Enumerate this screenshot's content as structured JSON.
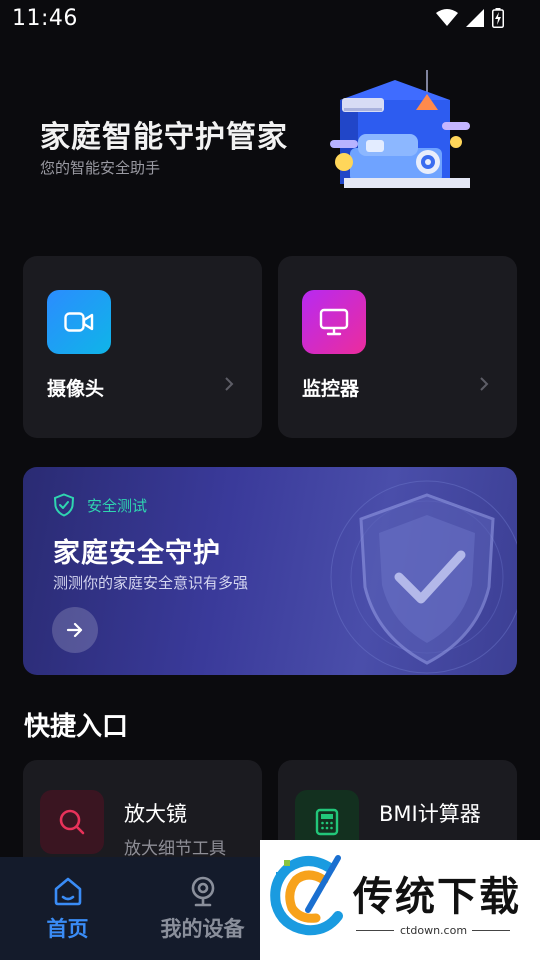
{
  "status_bar": {
    "time": "11:46"
  },
  "hero": {
    "title": "家庭智能守护管家",
    "subtitle": "您的智能安全助手"
  },
  "cards": [
    {
      "label": "摄像头",
      "icon": "video-camera-icon",
      "color": "#1e9bf0"
    },
    {
      "label": "监控器",
      "icon": "monitor-icon",
      "color": "#d52bd8"
    }
  ],
  "banner": {
    "tag": "安全测试",
    "title": "家庭安全守护",
    "subtitle": "测测你的家庭安全意识有多强",
    "accent": "#2fd5b0"
  },
  "quick_access": {
    "title": "快捷入口",
    "items": [
      {
        "title": "放大镜",
        "subtitle": "放大细节工具",
        "icon": "search-icon",
        "color": "#e8325a"
      },
      {
        "title": "BMI计算器",
        "subtitle": "",
        "icon": "calculator-icon",
        "color": "#22c77a"
      }
    ]
  },
  "tabs": [
    {
      "label": "首页",
      "icon": "home-icon",
      "active": true,
      "color": "#3a8cf6"
    },
    {
      "label": "我的设备",
      "icon": "webcam-icon",
      "active": false,
      "color": "#8a8f9b"
    }
  ],
  "watermark": {
    "text": "传统下载",
    "url": "ctdown.com"
  }
}
